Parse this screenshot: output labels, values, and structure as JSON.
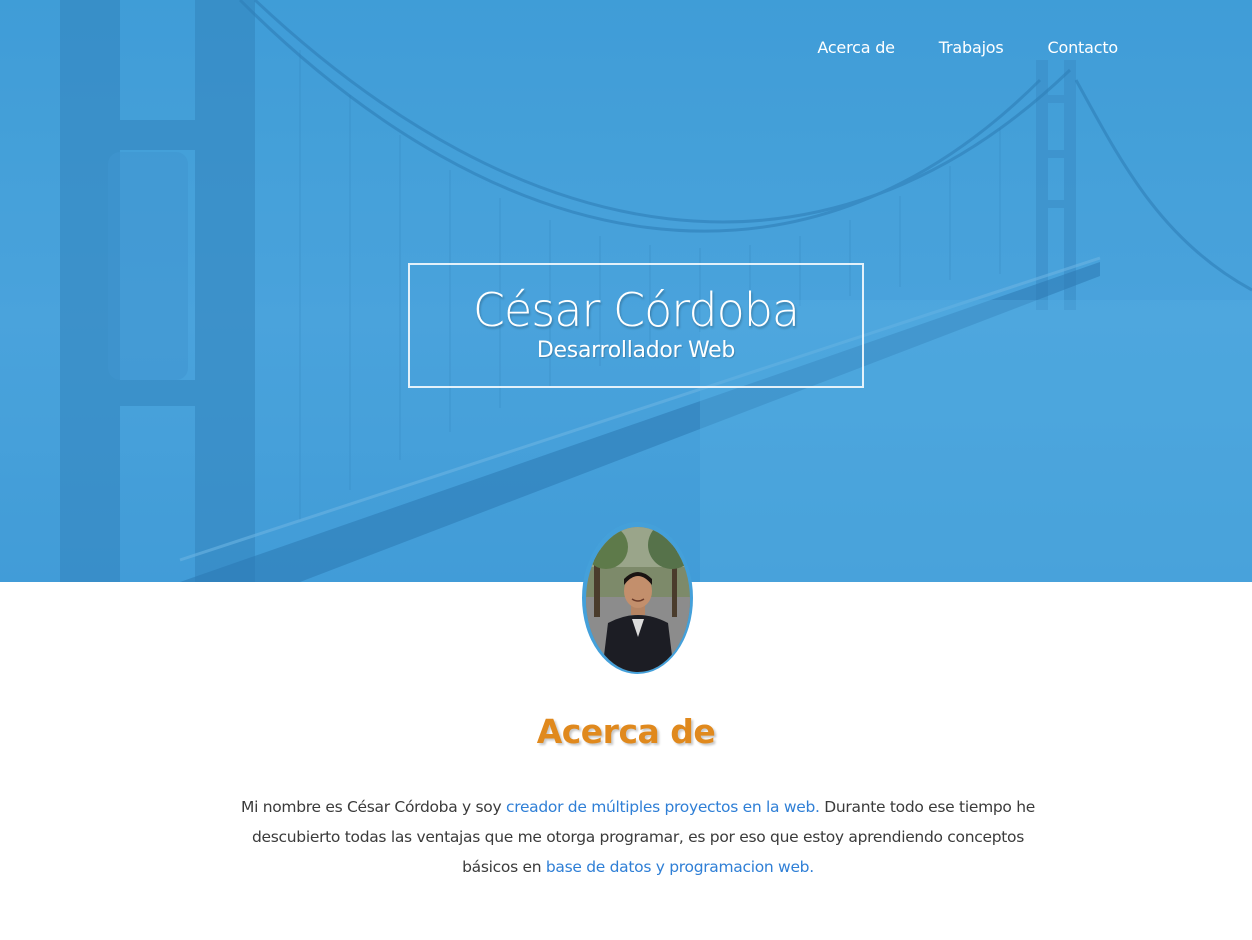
{
  "nav": {
    "items": [
      {
        "label": "Acerca de"
      },
      {
        "label": "Trabajos"
      },
      {
        "label": "Contacto"
      }
    ]
  },
  "hero": {
    "name": "César Córdoba",
    "role": "Desarrollador Web"
  },
  "about": {
    "heading": "Acerca de",
    "text_1": "Mi nombre es César Córdoba y soy ",
    "link_1": "creador de múltiples proyectos en la web.",
    "text_2": " Durante todo ese tiempo he descubierto todas las ventajas que me otorga programar, es por eso que estoy aprendiendo conceptos básicos en ",
    "link_2": "base de datos y programacion web."
  },
  "colors": {
    "hero_blue": "#44a0da",
    "heading_orange": "#e0891d",
    "link_blue": "#2f7fd6",
    "body_text": "#3b3b3b"
  }
}
